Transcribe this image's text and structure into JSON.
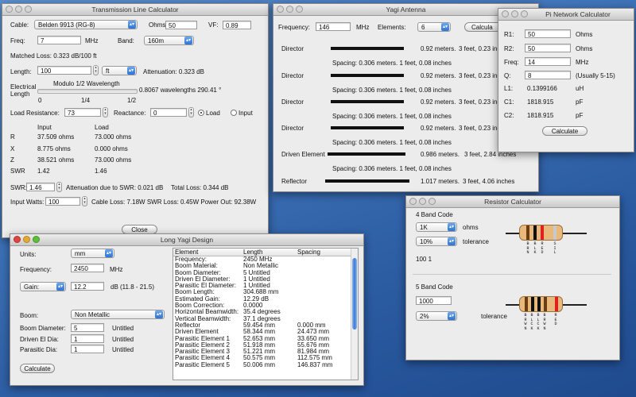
{
  "tl": {
    "title": "Transmission Line Calculator",
    "cable_label": "Cable:",
    "cable_value": "Belden 9913 (RG-8)",
    "ohms_label": "Ohms:",
    "ohms_value": "50",
    "vf_label": "VF:",
    "vf_value": "0.89",
    "freq_label": "Freq:",
    "freq_value": "7",
    "freq_unit": "MHz",
    "band_label": "Band:",
    "band_value": "160m",
    "matched_loss": "Matched Loss: 0.323 dB/100 ft",
    "length_label": "Length:",
    "length_value": "100",
    "length_unit": "ft",
    "attenuation": "Attenuation: 0.323 dB",
    "electrical_label": "Electrical Length",
    "modulo_label": "Modulo 1/2 Wavelength",
    "wavelengths": "0.8067 wavelengths  290.41 °",
    "tick_0": "0",
    "tick_14": "1/4",
    "tick_12": "1/2",
    "load_res_label": "Load Resistance:",
    "load_res_value": "73",
    "reactance_label": "Reactance:",
    "reactance_value": "0",
    "radio_load": "Load",
    "radio_input": "Input",
    "col_input": "Input",
    "col_load": "Load",
    "rows": [
      {
        "label": "R",
        "input": "37.509 ohms",
        "load": "73.000 ohms"
      },
      {
        "label": "X",
        "input": "8.775 ohms",
        "load": "0.000 ohms"
      },
      {
        "label": "Z",
        "input": "38.521 ohms",
        "load": "73.000 ohms"
      },
      {
        "label": "SWR",
        "input": "1.42",
        "load": "1.46"
      }
    ],
    "swr_label": "SWR:",
    "swr_value": "1.46",
    "att_swr": "Attenuation due to SWR:  0.021 dB",
    "total_loss": "Total Loss: 0.344 dB",
    "input_watts_label": "Input Watts:",
    "input_watts_value": "100",
    "power_line": "Cable Loss: 7.18W   SWR Loss: 0.45W   Power Out: 92.38W",
    "close_label": "Close"
  },
  "yagi": {
    "title": "Yagi Antenna",
    "freq_label": "Frequency:",
    "freq_value": "146",
    "freq_unit": "MHz",
    "elements_label": "Elements:",
    "elements_value": "6",
    "calc_label": "Calcula",
    "elements": [
      {
        "name": "Director",
        "length": "0.92 meters.",
        "feet": "3 feet, 0.23 inc",
        "bar": 0.85
      },
      {
        "name": "Director",
        "length": "0.92 meters.",
        "feet": "3 feet, 0.23 inc",
        "bar": 0.85
      },
      {
        "name": "Director",
        "length": "0.92 meters.",
        "feet": "3 feet, 0.23 inc",
        "bar": 0.85
      },
      {
        "name": "Director",
        "length": "0.92 meters.",
        "feet": "3 feet, 0.23 inc",
        "bar": 0.85
      },
      {
        "name": "Driven Element",
        "length": "0.986 meters.",
        "feet": "3 feet, 2.84 inches",
        "bar": 0.91
      },
      {
        "name": "Reflector",
        "length": "1.017 meters.",
        "feet": "3 feet, 4.06 inches",
        "bar": 0.98
      }
    ],
    "spacing": "Spacing: 0.306 meters.  1 feet, 0.08 inches"
  },
  "pi": {
    "title": "Pi Network Calculator",
    "r1_label": "R1:",
    "r1_value": "50",
    "r1_unit": "Ohms",
    "r2_label": "R2:",
    "r2_value": "50",
    "r2_unit": "Ohms",
    "freq_label": "Freq:",
    "freq_value": "14",
    "freq_unit": "MHz",
    "q_label": "Q:",
    "q_value": "8",
    "q_unit": "(Usually 5-15)",
    "l1_label": "L1:",
    "l1_value": "0.1399166",
    "l1_unit": "uH",
    "c1_label": "C1:",
    "c1_value": "1818.915",
    "c1_unit": "pF",
    "c2_label": "C2:",
    "c2_value": "1818.915",
    "c2_unit": "pF",
    "calc_label": "Calculate"
  },
  "res": {
    "title": "Resistor Calculator",
    "four_band_label": "4 Band Code",
    "four_value": "1K",
    "four_unit": "ohms",
    "four_tol": "10%",
    "four_tol_label": "tolerance",
    "four_code": "100 1",
    "five_band_label": "5 Band Code",
    "five_value": "1000",
    "five_tol": "2%",
    "five_tol_label": "tolerance",
    "four_bands": [
      "#6b3b12",
      "#111111",
      "#e02020",
      "#c9c9c9"
    ],
    "four_band_names": [
      "BRN",
      "BLK",
      "RED",
      "SIL"
    ],
    "five_bands": [
      "#6b3b12",
      "#111111",
      "#111111",
      "#6b3b12",
      "#e02020"
    ],
    "five_band_names": [
      "BRWN",
      "BLCK",
      "BLCK",
      "BRWN",
      "RED"
    ]
  },
  "ly": {
    "title": "Long Yagi Design",
    "units_label": "Units:",
    "units_value": "mm",
    "freq_label": "Frequency:",
    "freq_value": "2450",
    "freq_unit": "MHz",
    "gain_sel": "Gain:",
    "gain_value": "12.2",
    "gain_range": "dB (11.8 - 21.5)",
    "boom_label": "Boom:",
    "boom_value": "Non Metallic",
    "boom_dia_label": "Boom Diameter:",
    "boom_dia_value": "5",
    "boom_dia_unit": "Untitled",
    "driven_label": "Driven El Dia:",
    "driven_value": "1",
    "driven_unit": "Untitled",
    "parasitic_label": "Parasitic Dia:",
    "parasitic_value": "1",
    "parasitic_unit": "Untitled",
    "calc_label": "Calculate",
    "col_element": "Element",
    "col_length": "Length",
    "col_spacing": "Spacing",
    "table": [
      [
        "Frequency:",
        "2450 MHz",
        ""
      ],
      [
        "Boom Material:",
        "Non Metallic",
        ""
      ],
      [
        "Boom Diameter:",
        "5 Untitled",
        ""
      ],
      [
        "Driven El Diameter:",
        "1 Untitled",
        ""
      ],
      [
        "Parasitic El Diameter:",
        "1 Untitled",
        ""
      ],
      [
        "Boom Length:",
        "304.688 mm",
        ""
      ],
      [
        "Estimated Gain:",
        "12.29 dB",
        ""
      ],
      [
        "Boom Correction:",
        "0.0000",
        ""
      ],
      [
        "Horizontal Beamwidth:",
        "35.4 degrees",
        ""
      ],
      [
        "Vertical Beamwidth:",
        "37.1 degrees",
        ""
      ],
      [
        "Reflector",
        "59.454 mm",
        "0.000 mm"
      ],
      [
        "Driven Element",
        "58.344 mm",
        "24.473 mm"
      ],
      [
        "Parasitic Element 1",
        "52.653 mm",
        "33.650 mm"
      ],
      [
        "Parasitic Element 2",
        "51.918 mm",
        "55.676 mm"
      ],
      [
        "Parasitic Element 3",
        "51.221 mm",
        "81.984 mm"
      ],
      [
        "Parasitic Element 4",
        "50.575 mm",
        "112.575 mm"
      ],
      [
        "Parasitic Element 5",
        "50.006 mm",
        "146.837 mm"
      ]
    ]
  }
}
